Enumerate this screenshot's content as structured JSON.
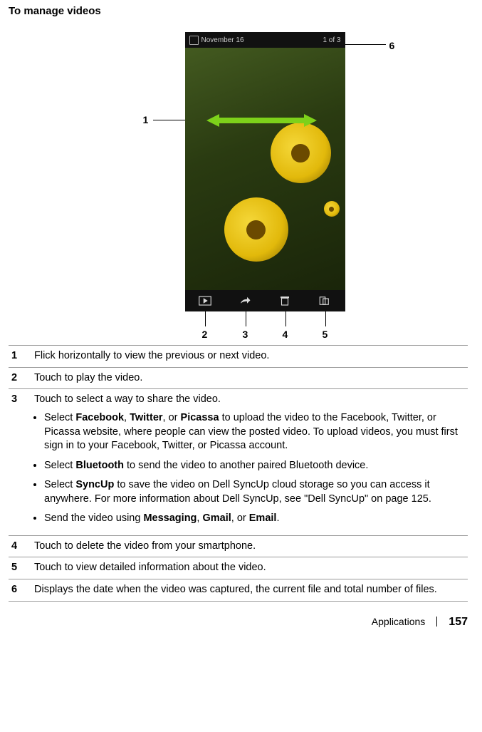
{
  "heading": "To manage videos",
  "phone": {
    "date_label": "November 16",
    "counter": "1 of 3"
  },
  "callouts": {
    "l1": "1",
    "l2": "2",
    "l3": "3",
    "l4": "4",
    "l5": "5",
    "l6": "6"
  },
  "defs": {
    "r1": "Flick horizontally to view the previous or next video.",
    "r2": "Touch to play the video.",
    "r3": {
      "intro": "Touch to select a way to share the video.",
      "b1_pre": "Select ",
      "b1_a": "Facebook",
      "b1_sep1": ", ",
      "b1_b": "Twitter",
      "b1_sep2": ", or ",
      "b1_c": "Picassa",
      "b1_post": " to upload the video to the Facebook, Twitter, or Picassa website, where people can view the posted video. To upload videos, you must first sign in to your Facebook, Twitter, or Picassa account.",
      "b2_pre": "Select ",
      "b2_a": "Bluetooth",
      "b2_post": " to send the video to another paired Bluetooth device.",
      "b3_pre": "Select ",
      "b3_a": "SyncUp",
      "b3_post": " to save the video on Dell SyncUp cloud storage so you can access it anywhere. For more information about Dell SyncUp, see \"Dell SyncUp\" on page 125.",
      "b4_pre": "Send the video using ",
      "b4_a": "Messaging",
      "b4_sep1": ", ",
      "b4_b": "Gmail",
      "b4_sep2": ", or ",
      "b4_c": "Email",
      "b4_post": "."
    },
    "r4": "Touch to delete the video from your smartphone.",
    "r5": "Touch to view detailed information about the video.",
    "r6": "Displays the date when the video was captured, the current file and total number of files."
  },
  "footer": {
    "section": "Applications",
    "page": "157"
  }
}
